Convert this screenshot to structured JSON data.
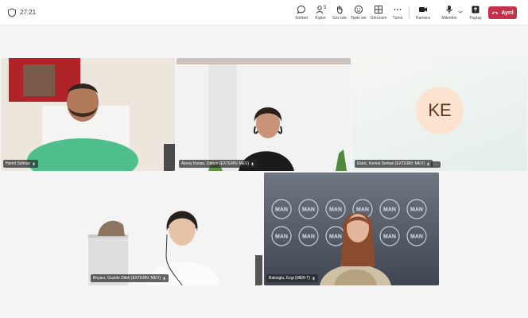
{
  "topbar": {
    "timer": "27:21",
    "tools": {
      "chat": "Sohbet",
      "people": "Kişiler",
      "people_count": "5",
      "raise": "Söz iste",
      "react": "Tepki ver",
      "view": "Görünüm",
      "more": "Tümü",
      "camera": "Kamera",
      "mic": "Mikrofon",
      "share": "Paylaş"
    },
    "leave_label": "Ayrıl"
  },
  "participants": [
    {
      "name": "Hamit Solmaz"
    },
    {
      "name": "Aksoy Kosan, Didem (EXTERN: MEV)"
    },
    {
      "name": "Ekbic, Kemal Serkan (EXTERN: MEV)",
      "initials": "KE"
    },
    {
      "name": "Boyacı, Guzide Dilek (EXTERN: MEV)"
    },
    {
      "name": "Bakioglu, Ezgi (MEB-T)"
    }
  ],
  "colors": {
    "leave": "#c4314b",
    "avatar_bg": "#fbe3cf",
    "man_backdrop": "#5a6270"
  },
  "man_logo_text": "MAN"
}
